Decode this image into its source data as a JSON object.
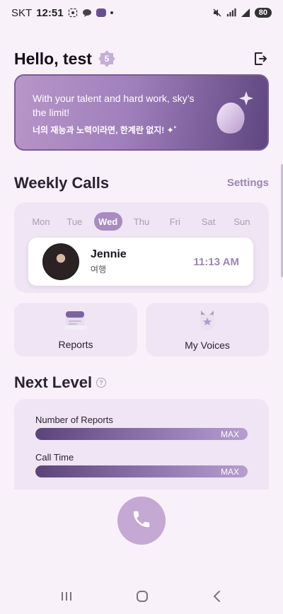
{
  "status_bar": {
    "carrier": "SKT",
    "time": "12:51",
    "battery": "80"
  },
  "header": {
    "greeting": "Hello, test",
    "level": "5",
    "logout_icon": "logout-icon"
  },
  "banner": {
    "text_en": "With your talent and hard work, sky’s the limit!",
    "text_ko": "너의 재능과 노력이라면, 한계란 없지! ✦˚"
  },
  "weekly_calls": {
    "title": "Weekly Calls",
    "settings_label": "Settings",
    "days": [
      "Mon",
      "Tue",
      "Wed",
      "Thu",
      "Fri",
      "Sat",
      "Sun"
    ],
    "active_day": "Wed",
    "call": {
      "name": "Jennie",
      "subtitle": "여행",
      "time": "11:13 AM"
    }
  },
  "tiles": {
    "reports_label": "Reports",
    "voices_label": "My Voices"
  },
  "next_level": {
    "title": "Next Level",
    "items": [
      {
        "label": "Number of Reports",
        "value_text": "MAX",
        "progress": 1.0
      },
      {
        "label": "Call Time",
        "value_text": "MAX",
        "progress": 1.0
      }
    ]
  },
  "colors": {
    "accent": "#a98bc0",
    "accent_dark": "#5b4479",
    "background": "#f8f1fa",
    "card": "#efe5f4"
  }
}
